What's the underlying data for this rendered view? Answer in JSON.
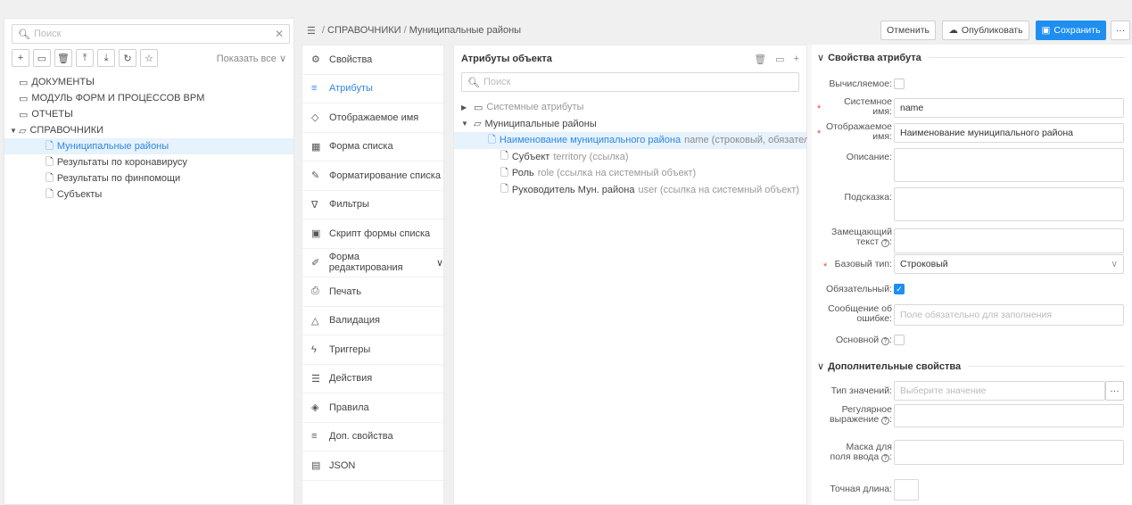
{
  "left": {
    "search_placeholder": "Поиск",
    "show_all": "Показать все",
    "tree": [
      {
        "label": "ДОКУМЕНТЫ",
        "caret": "",
        "icon": "folder",
        "indent": 0,
        "selected": false
      },
      {
        "label": "МОДУЛЬ ФОРМ И ПРОЦЕССОВ BPM",
        "caret": "",
        "icon": "folder",
        "indent": 0,
        "selected": false
      },
      {
        "label": "ОТЧЕТЫ",
        "caret": "",
        "icon": "folder",
        "indent": 0,
        "selected": false
      },
      {
        "label": "СПРАВОЧНИКИ",
        "caret": "▼",
        "icon": "folder-open",
        "indent": 0,
        "selected": false
      },
      {
        "label": "Муниципальные районы",
        "caret": "",
        "icon": "file",
        "indent": 1,
        "selected": true
      },
      {
        "label": "Результаты по коронавирусу",
        "caret": "",
        "icon": "file",
        "indent": 1,
        "selected": false
      },
      {
        "label": "Результаты по финпомощи",
        "caret": "",
        "icon": "file",
        "indent": 1,
        "selected": false
      },
      {
        "label": "Субъекты",
        "caret": "",
        "icon": "file",
        "indent": 1,
        "selected": false
      }
    ]
  },
  "breadcrumb": {
    "sep": "/",
    "section": "СПРАВОЧНИКИ",
    "current": "Муниципальные районы"
  },
  "actions": {
    "cancel": "Отменить",
    "publish": "Опубликовать",
    "save": "Сохранить",
    "more": "···"
  },
  "menu": [
    {
      "label": "Свойства",
      "icon": "gear",
      "active": false
    },
    {
      "label": "Атрибуты",
      "icon": "list",
      "active": true
    },
    {
      "label": "Отображаемое имя",
      "icon": "tag",
      "active": false
    },
    {
      "label": "Форма списка",
      "icon": "table",
      "active": false
    },
    {
      "label": "Форматирование списка",
      "icon": "brush",
      "active": false
    },
    {
      "label": "Фильтры",
      "icon": "filter",
      "active": false
    },
    {
      "label": "Скрипт формы списка",
      "icon": "script",
      "active": false
    },
    {
      "label": "Форма редактирования",
      "icon": "edit",
      "active": false
    },
    {
      "label": "Печать",
      "icon": "print",
      "active": false
    },
    {
      "label": "Валидация",
      "icon": "warning",
      "active": false
    },
    {
      "label": "Триггеры",
      "icon": "trigger",
      "active": false
    },
    {
      "label": "Действия",
      "icon": "menu",
      "active": false
    },
    {
      "label": "Правила",
      "icon": "rules",
      "active": false
    },
    {
      "label": "Доп. свойства",
      "icon": "list",
      "active": false
    },
    {
      "label": "JSON",
      "icon": "json",
      "active": false
    }
  ],
  "attrs": {
    "title": "Атрибуты объекта",
    "search_placeholder": "Поиск",
    "rows": [
      {
        "caret": "▶",
        "icon": "folder",
        "name": "Системные атрибуты",
        "meta": "",
        "indent": 0,
        "selected": false,
        "muted": true
      },
      {
        "caret": "▼",
        "icon": "folder-open",
        "name": "Муниципальные районы",
        "meta": "",
        "indent": 0,
        "selected": false,
        "muted": false
      },
      {
        "caret": "",
        "icon": "file",
        "name": "Наименование муниципального района",
        "meta": "name (строковый, обязательный)",
        "indent": 1,
        "selected": true,
        "muted": false
      },
      {
        "caret": "",
        "icon": "file",
        "name": "Субъект",
        "meta": "territory (ссылка)",
        "indent": 1,
        "selected": false,
        "muted": false
      },
      {
        "caret": "",
        "icon": "file",
        "name": "Роль",
        "meta": "role (ссылка на системный объект)",
        "indent": 1,
        "selected": false,
        "muted": false
      },
      {
        "caret": "",
        "icon": "file",
        "name": "Руководитель Мун. района",
        "meta": "user (ссылка на системный объект)",
        "indent": 1,
        "selected": false,
        "muted": false
      }
    ]
  },
  "props": {
    "section1": "Свойства атрибута",
    "computed_label": "Вычисляемое",
    "sysname_label": "Системное имя",
    "sysname_value": "name",
    "display_label": "Отображаемое имя",
    "display_value": "Наименование муниципального района",
    "desc_label": "Описание",
    "hint_label": "Подсказка",
    "placeholder_label": "Замещающий текст",
    "basetype_label": "Базовый тип",
    "basetype_value": "Строковый",
    "required_label": "Обязательный",
    "errmsg_label": "Сообщение об ошибке",
    "errmsg_placeholder": "Поле обязательно для заполнения",
    "main_label": "Основной",
    "section2": "Дополнительные свойства",
    "valtype_label": "Тип значений",
    "valtype_placeholder": "Выберите значение",
    "regex_label": "Регулярное выражение",
    "mask_label": "Маска для поля ввода",
    "length_label": "Точная длина",
    "colon": ":",
    "required_mark": "*"
  }
}
